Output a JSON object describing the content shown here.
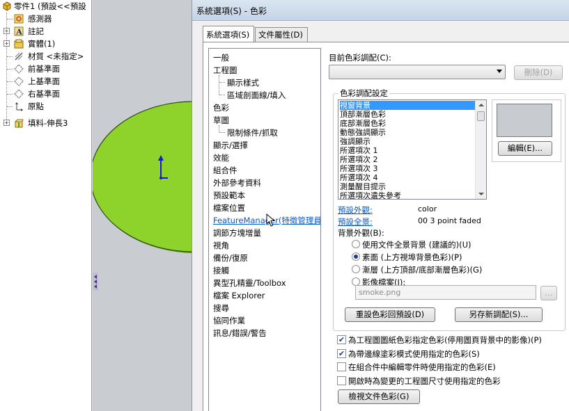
{
  "tree": {
    "items": [
      {
        "label": "零件1 (預設<<預設",
        "icon": "part-icon",
        "level": 0,
        "expander": "-"
      },
      {
        "label": "感測器",
        "icon": "sensor-icon",
        "level": 1,
        "expander": ""
      },
      {
        "label": "註記",
        "icon": "annotation-icon",
        "level": 1,
        "expander": "+"
      },
      {
        "label": "實體(1)",
        "icon": "solid-bodies-icon",
        "level": 1,
        "expander": "+"
      },
      {
        "label": "材質 <未指定>",
        "icon": "material-icon",
        "level": 1,
        "expander": ""
      },
      {
        "label": "前基準面",
        "icon": "plane-icon",
        "level": 1,
        "expander": ""
      },
      {
        "label": "上基準面",
        "icon": "plane-icon",
        "level": 1,
        "expander": ""
      },
      {
        "label": "右基準面",
        "icon": "plane-icon",
        "level": 1,
        "expander": ""
      },
      {
        "label": "原點",
        "icon": "origin-icon",
        "level": 1,
        "expander": ""
      },
      {
        "label": "填料-伸長3",
        "icon": "extrude-feature-icon",
        "level": 1,
        "expander": "+"
      }
    ]
  },
  "dialog": {
    "title": "系統選項(S) - 色彩",
    "tabs": [
      {
        "label": "系統選項(S)",
        "active": true
      },
      {
        "label": "文件屬性(D)",
        "active": false
      }
    ],
    "categories": [
      {
        "label": "一般",
        "sub": false
      },
      {
        "label": "工程圖",
        "sub": false
      },
      {
        "label": "顯示樣式",
        "sub": true
      },
      {
        "label": "區域剖面線/填入",
        "sub": true
      },
      {
        "label": "色彩",
        "sub": false
      },
      {
        "label": "草圖",
        "sub": false
      },
      {
        "label": "限制條件/抓取",
        "sub": true
      },
      {
        "label": "顯示/選擇",
        "sub": false
      },
      {
        "label": "效能",
        "sub": false
      },
      {
        "label": "組合件",
        "sub": false
      },
      {
        "label": "外部參考資料",
        "sub": false
      },
      {
        "label": "預設範本",
        "sub": false
      },
      {
        "label": "檔案位置",
        "sub": false
      },
      {
        "label": "FeatureManager(特徵管理員",
        "sub": false,
        "link": true
      },
      {
        "label": "調節方塊增量",
        "sub": false
      },
      {
        "label": "視角",
        "sub": false
      },
      {
        "label": "備份/復原",
        "sub": false
      },
      {
        "label": "接觸",
        "sub": false
      },
      {
        "label": "異型孔精靈/Toolbox",
        "sub": false
      },
      {
        "label": "檔案 Explorer",
        "sub": false
      },
      {
        "label": "搜尋",
        "sub": false
      },
      {
        "label": "協同作業",
        "sub": false
      },
      {
        "label": "訊息/錯誤/警告",
        "sub": false
      }
    ],
    "current_scheme_label": "目前色彩調配(C):",
    "current_scheme_value": "",
    "delete_button": "刪除(D)",
    "scheme_group_title": "色彩調配設定",
    "scheme_items": [
      {
        "label": "視窗背景",
        "selected": true
      },
      {
        "label": "頂部漸層色彩",
        "selected": false
      },
      {
        "label": "底部漸層色彩",
        "selected": false
      },
      {
        "label": "動態強調顯示",
        "selected": false
      },
      {
        "label": "強調顯示",
        "selected": false
      },
      {
        "label": "所選項次 1",
        "selected": false
      },
      {
        "label": "所選項次 2",
        "selected": false
      },
      {
        "label": "所選項次 3",
        "selected": false
      },
      {
        "label": "所選項次 4",
        "selected": false
      },
      {
        "label": "測量醒目提示",
        "selected": false
      },
      {
        "label": "所選項次遺失參考",
        "selected": false
      }
    ],
    "swatch_color": "#c8cbd0",
    "edit_button": "編輯(E)...",
    "default_appearance_link": "預設外觀:",
    "default_appearance_value": "color",
    "default_scene_link": "預設全景:",
    "default_scene_value": "00 3 point faded",
    "background_label": "背景外觀(B):",
    "background_options": [
      {
        "label": "使用文件全景背景 (建議的)(U)",
        "selected": false
      },
      {
        "label": "素面 (上方視埠背景色彩)(P)",
        "selected": true
      },
      {
        "label": "漸層 (上方頂部/底部漸層色彩)(G)",
        "selected": false
      },
      {
        "label": "影像檔案(I):",
        "selected": false
      }
    ],
    "image_file_value": "smoke.png",
    "browse_button": "...",
    "reset_button": "重設色彩回預設(D)",
    "save_as_button": "另存新調配(S)...",
    "checkboxes": [
      {
        "label": "為工程圖圖紙色彩指定色彩(停用圖頁背景中的影像)(P)",
        "checked": true
      },
      {
        "label": "為帶邊線塗彩模式使用指定的色彩(S)",
        "checked": true
      },
      {
        "label": "在組合件中編輯零件時使用指定的色彩(E)",
        "checked": false
      },
      {
        "label": "開啟時為變更的工程圖尺寸使用指定的色彩",
        "checked": false
      }
    ],
    "view_doc_colors_button": "檢視文件色彩(G)"
  },
  "colors": {
    "part_green": "#8ed22c",
    "part_edge": "#2d4a10",
    "triad_blue": "#1a1ad0",
    "graphics_bg": "#c9cdd2",
    "link_blue": "#0a5ac6",
    "selection_blue": "#3399ff"
  }
}
